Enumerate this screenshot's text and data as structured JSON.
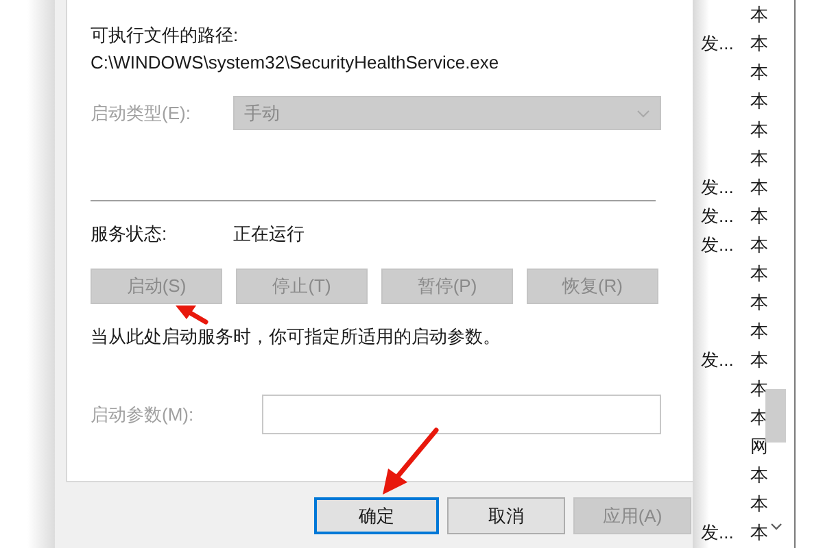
{
  "path_label": "可执行文件的路径:",
  "path": "C:\\WINDOWS\\system32\\SecurityHealthService.exe",
  "startup_type": {
    "label": "启动类型(E):",
    "value": "手动",
    "disabled": true
  },
  "status": {
    "label": "服务状态:",
    "value": "正在运行"
  },
  "service_buttons": [
    {
      "label": "启动(S)",
      "disabled": true
    },
    {
      "label": "停止(T)",
      "disabled": true
    },
    {
      "label": "暂停(P)",
      "disabled": true
    },
    {
      "label": "恢复(R)",
      "disabled": true
    }
  ],
  "hint": "当从此处启动服务时，你可指定所适用的启动参数。",
  "parameters": {
    "label": "启动参数(M):",
    "disabled": true
  },
  "dialog_buttons": [
    {
      "label": "确定",
      "default": true,
      "disabled": false
    },
    {
      "label": "取消",
      "default": false,
      "disabled": false
    },
    {
      "label": "应用(A)",
      "default": false,
      "disabled": true
    }
  ],
  "background_list": {
    "rows": [
      {
        "column_2": "本"
      },
      {
        "column_1": "发...",
        "column_2": "本"
      },
      {
        "column_2": "本"
      },
      {
        "column_2": "本"
      },
      {
        "column_2": "本"
      },
      {
        "column_2": "本"
      },
      {
        "column_1": "发...",
        "column_2": "本"
      },
      {
        "column_1": "发...",
        "column_2": "本"
      },
      {
        "column_1": "发...",
        "column_2": "本"
      },
      {
        "column_2": "本"
      },
      {
        "column_2": "本"
      },
      {
        "column_2": "本"
      },
      {
        "column_1": "发...",
        "column_2": "本"
      },
      {
        "column_2": "本"
      },
      {
        "column_2": "本"
      },
      {
        "column_2": "网"
      },
      {
        "column_2": "本"
      },
      {
        "column_2": "本"
      },
      {
        "column_1": "发...",
        "column_2": "本"
      }
    ]
  }
}
